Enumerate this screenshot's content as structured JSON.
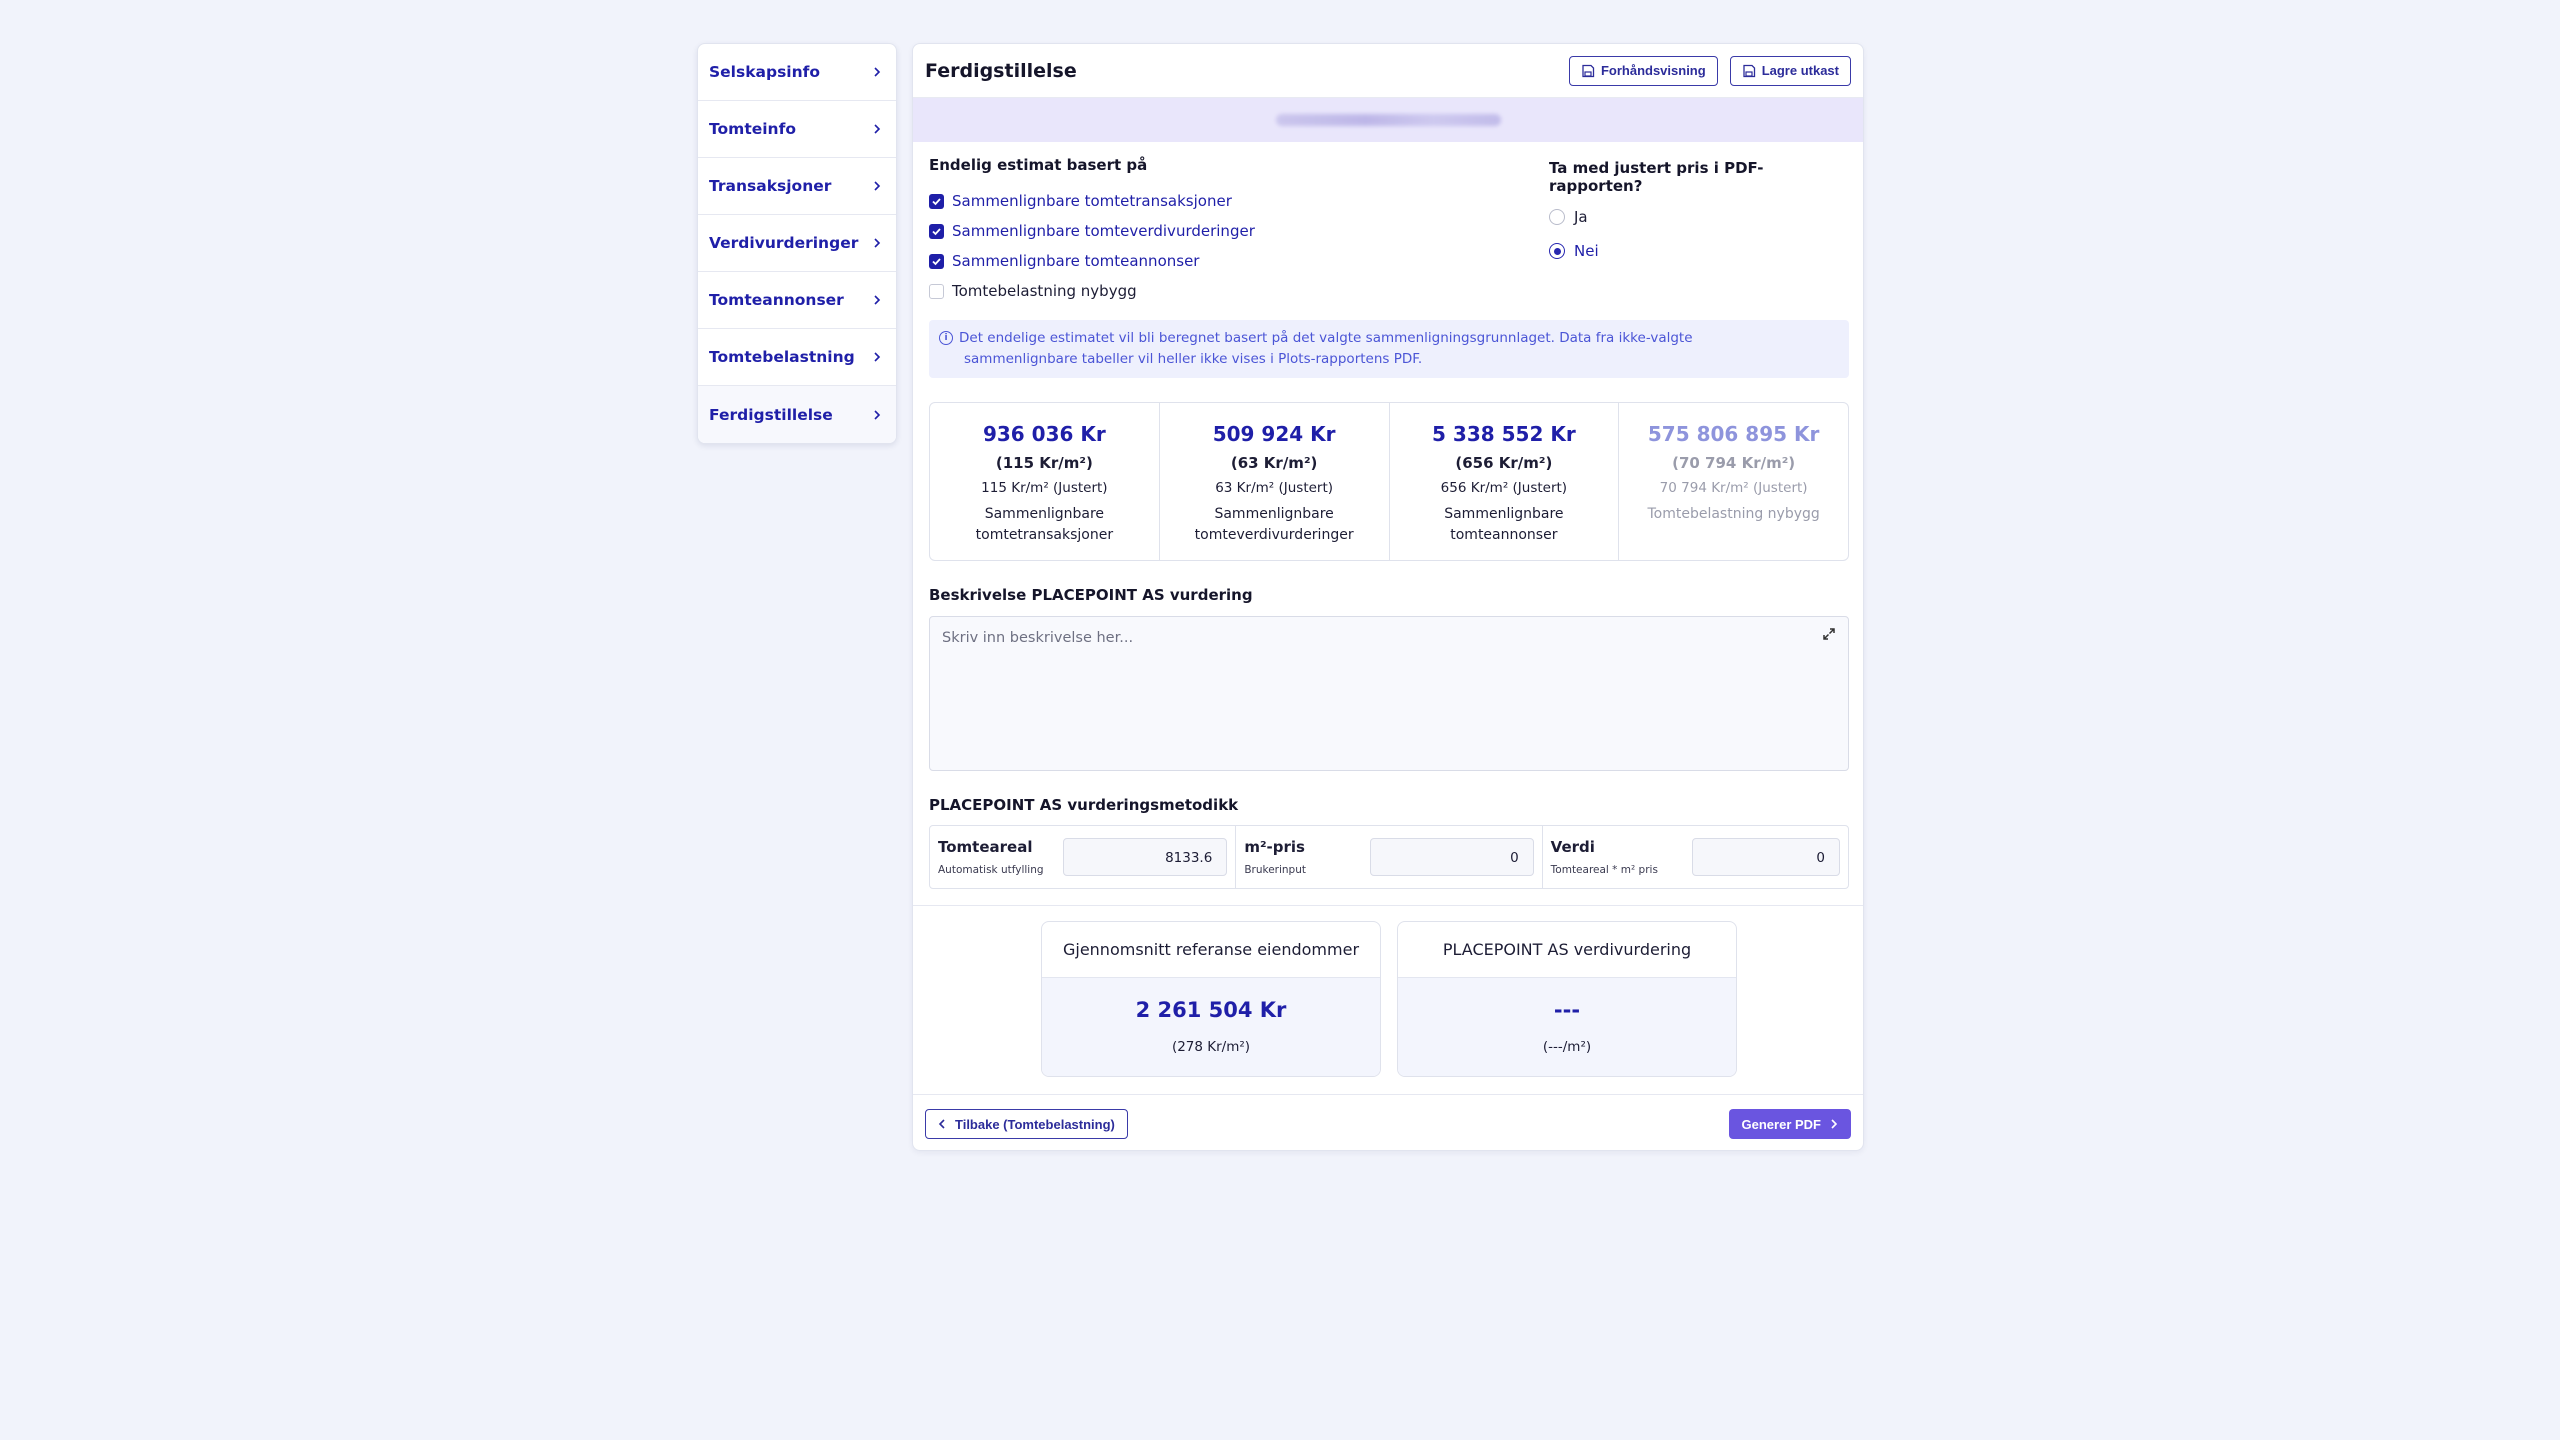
{
  "sidebar": {
    "items": [
      {
        "label": "Selskapsinfo"
      },
      {
        "label": "Tomteinfo"
      },
      {
        "label": "Transaksjoner"
      },
      {
        "label": "Verdivurderinger"
      },
      {
        "label": "Tomteannonser"
      },
      {
        "label": "Tomtebelastning"
      },
      {
        "label": "Ferdigstillelse"
      }
    ]
  },
  "header": {
    "title": "Ferdigstillelse",
    "preview_label": "Forhåndsvisning",
    "save_draft_label": "Lagre utkast"
  },
  "estimate": {
    "heading": "Endelig estimat basert på",
    "options": [
      {
        "label": "Sammenlignbare tomtetransaksjoner",
        "checked": true
      },
      {
        "label": "Sammenlignbare tomteverdivurderinger",
        "checked": true
      },
      {
        "label": "Sammenlignbare tomteannonser",
        "checked": true
      },
      {
        "label": "Tomtebelastning nybygg",
        "checked": false
      }
    ]
  },
  "pdf_option": {
    "question": "Ta med justert pris i PDF-rapporten?",
    "yes_label": "Ja",
    "no_label": "Nei",
    "selected": "Nei"
  },
  "info": {
    "icon": "info-icon",
    "line1": "Det endelige estimatet vil bli beregnet basert på det valgte sammenligningsgrunnlaget. Data fra ikke-valgte",
    "line2": "sammenlignbare tabeller vil heller ikke vises i Plots-rapportens PDF."
  },
  "stats": [
    {
      "value": "936 036 Kr",
      "per_m2": "(115 Kr/m²)",
      "adjusted": "115 Kr/m² (Justert)",
      "name_line1": "Sammenlignbare",
      "name_line2": "tomtetransaksjoner"
    },
    {
      "value": "509 924 Kr",
      "per_m2": "(63 Kr/m²)",
      "adjusted": "63 Kr/m² (Justert)",
      "name_line1": "Sammenlignbare",
      "name_line2": "tomteverdivurderinger"
    },
    {
      "value": "5 338 552 Kr",
      "per_m2": "(656 Kr/m²)",
      "adjusted": "656 Kr/m² (Justert)",
      "name_line1": "Sammenlignbare",
      "name_line2": "tomteannonser"
    },
    {
      "value": "575 806 895 Kr",
      "per_m2": "(70 794 Kr/m²)",
      "adjusted": "70 794 Kr/m² (Justert)",
      "name_line1": "Tomtebelastning nybygg",
      "name_line2": ""
    }
  ],
  "description": {
    "label": "Beskrivelse PLACEPOINT AS vurdering",
    "placeholder": "Skriv inn beskrivelse her..."
  },
  "method": {
    "label": "PLACEPOINT AS vurderingsmetodikk",
    "fields": [
      {
        "title": "Tomteareal",
        "sub": "Automatisk utfylling",
        "value": "8133.6"
      },
      {
        "title": "m²-pris",
        "sub": "Brukerinput",
        "value": "0"
      },
      {
        "title": "Verdi",
        "sub": "Tomteareal * m² pris",
        "value": "0"
      }
    ]
  },
  "summary": {
    "reference": {
      "title": "Gjennomsnitt referanse eiendommer",
      "value": "2 261 504 Kr",
      "per_m2": "(278 Kr/m²)"
    },
    "placepoint": {
      "title": "PLACEPOINT AS verdivurdering",
      "value": "---",
      "per_m2": "(---/m²)"
    }
  },
  "footer": {
    "back_label": "Tilbake (Tomtebelastning)",
    "generate_label": "Generer PDF"
  },
  "colors": {
    "accent": "#1f1fa8",
    "primary_button": "#6a55e0",
    "background": "#f1f3fb"
  }
}
